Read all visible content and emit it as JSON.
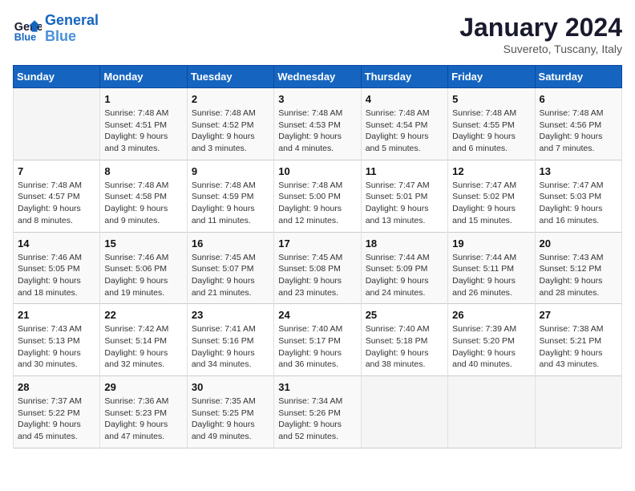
{
  "header": {
    "logo_line1": "General",
    "logo_line2": "Blue",
    "title": "January 2024",
    "subtitle": "Suvereto, Tuscany, Italy"
  },
  "weekdays": [
    "Sunday",
    "Monday",
    "Tuesday",
    "Wednesday",
    "Thursday",
    "Friday",
    "Saturday"
  ],
  "weeks": [
    [
      null,
      {
        "day": "1",
        "sunrise": "7:48 AM",
        "sunset": "4:51 PM",
        "daylight": "9 hours and 3 minutes."
      },
      {
        "day": "2",
        "sunrise": "7:48 AM",
        "sunset": "4:52 PM",
        "daylight": "9 hours and 3 minutes."
      },
      {
        "day": "3",
        "sunrise": "7:48 AM",
        "sunset": "4:53 PM",
        "daylight": "9 hours and 4 minutes."
      },
      {
        "day": "4",
        "sunrise": "7:48 AM",
        "sunset": "4:54 PM",
        "daylight": "9 hours and 5 minutes."
      },
      {
        "day": "5",
        "sunrise": "7:48 AM",
        "sunset": "4:55 PM",
        "daylight": "9 hours and 6 minutes."
      },
      {
        "day": "6",
        "sunrise": "7:48 AM",
        "sunset": "4:56 PM",
        "daylight": "9 hours and 7 minutes."
      }
    ],
    [
      {
        "day": "7",
        "sunrise": "7:48 AM",
        "sunset": "4:57 PM",
        "daylight": "9 hours and 8 minutes."
      },
      {
        "day": "8",
        "sunrise": "7:48 AM",
        "sunset": "4:58 PM",
        "daylight": "9 hours and 9 minutes."
      },
      {
        "day": "9",
        "sunrise": "7:48 AM",
        "sunset": "4:59 PM",
        "daylight": "9 hours and 11 minutes."
      },
      {
        "day": "10",
        "sunrise": "7:48 AM",
        "sunset": "5:00 PM",
        "daylight": "9 hours and 12 minutes."
      },
      {
        "day": "11",
        "sunrise": "7:47 AM",
        "sunset": "5:01 PM",
        "daylight": "9 hours and 13 minutes."
      },
      {
        "day": "12",
        "sunrise": "7:47 AM",
        "sunset": "5:02 PM",
        "daylight": "9 hours and 15 minutes."
      },
      {
        "day": "13",
        "sunrise": "7:47 AM",
        "sunset": "5:03 PM",
        "daylight": "9 hours and 16 minutes."
      }
    ],
    [
      {
        "day": "14",
        "sunrise": "7:46 AM",
        "sunset": "5:05 PM",
        "daylight": "9 hours and 18 minutes."
      },
      {
        "day": "15",
        "sunrise": "7:46 AM",
        "sunset": "5:06 PM",
        "daylight": "9 hours and 19 minutes."
      },
      {
        "day": "16",
        "sunrise": "7:45 AM",
        "sunset": "5:07 PM",
        "daylight": "9 hours and 21 minutes."
      },
      {
        "day": "17",
        "sunrise": "7:45 AM",
        "sunset": "5:08 PM",
        "daylight": "9 hours and 23 minutes."
      },
      {
        "day": "18",
        "sunrise": "7:44 AM",
        "sunset": "5:09 PM",
        "daylight": "9 hours and 24 minutes."
      },
      {
        "day": "19",
        "sunrise": "7:44 AM",
        "sunset": "5:11 PM",
        "daylight": "9 hours and 26 minutes."
      },
      {
        "day": "20",
        "sunrise": "7:43 AM",
        "sunset": "5:12 PM",
        "daylight": "9 hours and 28 minutes."
      }
    ],
    [
      {
        "day": "21",
        "sunrise": "7:43 AM",
        "sunset": "5:13 PM",
        "daylight": "9 hours and 30 minutes."
      },
      {
        "day": "22",
        "sunrise": "7:42 AM",
        "sunset": "5:14 PM",
        "daylight": "9 hours and 32 minutes."
      },
      {
        "day": "23",
        "sunrise": "7:41 AM",
        "sunset": "5:16 PM",
        "daylight": "9 hours and 34 minutes."
      },
      {
        "day": "24",
        "sunrise": "7:40 AM",
        "sunset": "5:17 PM",
        "daylight": "9 hours and 36 minutes."
      },
      {
        "day": "25",
        "sunrise": "7:40 AM",
        "sunset": "5:18 PM",
        "daylight": "9 hours and 38 minutes."
      },
      {
        "day": "26",
        "sunrise": "7:39 AM",
        "sunset": "5:20 PM",
        "daylight": "9 hours and 40 minutes."
      },
      {
        "day": "27",
        "sunrise": "7:38 AM",
        "sunset": "5:21 PM",
        "daylight": "9 hours and 43 minutes."
      }
    ],
    [
      {
        "day": "28",
        "sunrise": "7:37 AM",
        "sunset": "5:22 PM",
        "daylight": "9 hours and 45 minutes."
      },
      {
        "day": "29",
        "sunrise": "7:36 AM",
        "sunset": "5:23 PM",
        "daylight": "9 hours and 47 minutes."
      },
      {
        "day": "30",
        "sunrise": "7:35 AM",
        "sunset": "5:25 PM",
        "daylight": "9 hours and 49 minutes."
      },
      {
        "day": "31",
        "sunrise": "7:34 AM",
        "sunset": "5:26 PM",
        "daylight": "9 hours and 52 minutes."
      },
      null,
      null,
      null
    ]
  ],
  "labels": {
    "sunrise": "Sunrise:",
    "sunset": "Sunset:",
    "daylight": "Daylight:"
  }
}
